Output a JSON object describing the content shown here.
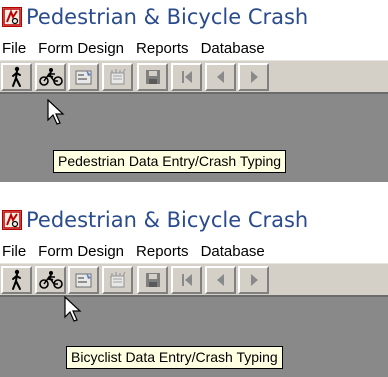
{
  "panels": [
    {
      "title": "Pedestrian & Bicycle Crash",
      "menu": [
        "File",
        "Form Design",
        "Reports",
        "Database"
      ],
      "toolbar_icons": [
        "pedestrian-icon",
        "bicyclist-icon",
        "properties-icon",
        "new-record-icon",
        "save-icon",
        "first-record-icon",
        "previous-record-icon",
        "next-record-icon"
      ],
      "pressed_button": "bicyclist-icon",
      "tooltip": "Pedestrian Data Entry/Crash Typing"
    },
    {
      "title": "Pedestrian & Bicycle Crash",
      "menu": [
        "File",
        "Form Design",
        "Reports",
        "Database"
      ],
      "toolbar_icons": [
        "pedestrian-icon",
        "bicyclist-icon",
        "properties-icon",
        "new-record-icon",
        "save-icon",
        "first-record-icon",
        "previous-record-icon",
        "next-record-icon"
      ],
      "pressed_button": "pedestrian-icon",
      "tooltip": "Bicyclist Data Entry/Crash Typing"
    }
  ],
  "colors": {
    "title_text": "#2a4b8d",
    "toolbar_face": "#d4d0c8",
    "workspace": "#898989",
    "tooltip_bg": "#ffffe1"
  }
}
